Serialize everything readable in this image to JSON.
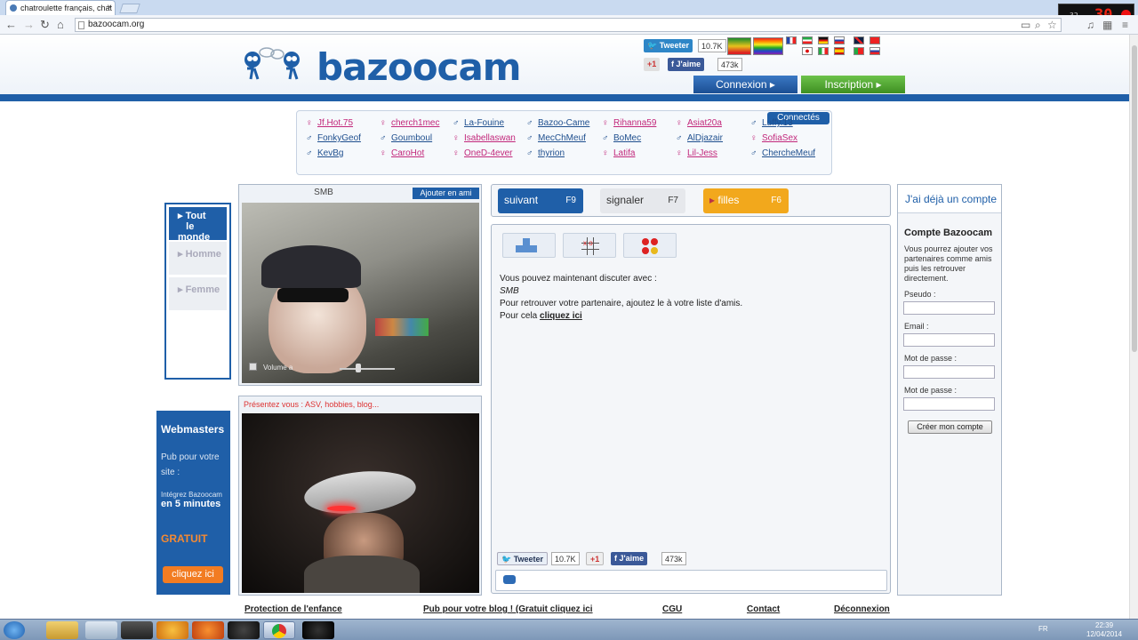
{
  "browser": {
    "tab_title": "chatroulette français, chat",
    "tab_close": "×",
    "url": "bazoocam.org",
    "rec_small": "32",
    "rec_big": "30"
  },
  "header": {
    "logo": "bazoocam",
    "tweet_label": "Tweeter",
    "tweet_count": "10.7K",
    "gplus_label": "+1",
    "fb_label": "J'aime",
    "fb_count": "473k",
    "connexion": "Connexion",
    "inscription": "Inscription"
  },
  "connected": {
    "title": "Connectés",
    "users": [
      {
        "name": "Jf.Hot.75",
        "g": "f"
      },
      {
        "name": "FonkyGeof",
        "g": "m"
      },
      {
        "name": "KevBg",
        "g": "m"
      },
      {
        "name": "cherch1mec",
        "g": "f"
      },
      {
        "name": "Goumboul",
        "g": "m"
      },
      {
        "name": "CaroHot",
        "g": "f"
      },
      {
        "name": "La-Fouine",
        "g": "m"
      },
      {
        "name": "Isabellaswan",
        "g": "f"
      },
      {
        "name": "OneD-4ever",
        "g": "f"
      },
      {
        "name": "Bazoo-Came",
        "g": "m"
      },
      {
        "name": "MecChMeuf",
        "g": "m"
      },
      {
        "name": "thyrion",
        "g": "m"
      },
      {
        "name": "Rihanna59",
        "g": "f"
      },
      {
        "name": "BoMec",
        "g": "m"
      },
      {
        "name": "Latifa",
        "g": "f"
      },
      {
        "name": "Asiat20a",
        "g": "f"
      },
      {
        "name": "AlDjazair",
        "g": "m"
      },
      {
        "name": "Lil-Jess",
        "g": "f"
      },
      {
        "name": "Luffy.13",
        "g": "m"
      },
      {
        "name": "SofiaSex",
        "g": "f"
      },
      {
        "name": "ChercheMeuf",
        "g": "m"
      }
    ]
  },
  "filter": {
    "all_1": "Tout",
    "all_2": "le monde",
    "men": "Homme",
    "women": "Femme"
  },
  "webmasters": {
    "title": "Webmasters",
    "pub": "Pub pour votre site :",
    "integrate": "Intégrez Bazoocam",
    "minutes": "en 5 minutes",
    "free": "GRATUIT",
    "cta": "cliquez ici"
  },
  "video": {
    "partner": "SMB",
    "add_friend": "Ajouter en ami",
    "volume": "Volume a",
    "self_hint": "Présentez vous : ASV, hobbies, blog..."
  },
  "actions": {
    "next": "suivant",
    "next_key": "F9",
    "report": "signaler",
    "report_key": "F7",
    "girls": "filles",
    "girls_key": "F6"
  },
  "chat": {
    "line1": "Vous pouvez maintenant discuter avec :",
    "partner": "SMB",
    "line3": "Pour retrouver votre partenaire, ajoutez le à votre liste d'amis.",
    "line4_pre": "Pour cela",
    "line4_link": "cliquez ici",
    "tweet": "Tweeter",
    "tweet_count": "10.7K",
    "gplus": "+1",
    "fb": "J'aime",
    "fb_count": "473k"
  },
  "account": {
    "have_account": "J'ai déjà un compte",
    "title": "Compte Bazoocam",
    "desc": "Vous pourrez ajouter vos partenaires comme amis puis les retrouver directement.",
    "pseudo": "Pseudo :",
    "email": "Email :",
    "password": "Mot de passe :",
    "password2": "Mot de passe :",
    "create": "Créer mon compte"
  },
  "footer": {
    "child": "Protection de l'enfance",
    "blog": "Pub pour votre blog ! (Gratuit cliquez ici",
    "cgu": "CGU",
    "contact": "Contact",
    "logout": "Déconnexion"
  },
  "taskbar": {
    "lang": "FR",
    "time": "22:39",
    "date": "12/04/2014"
  }
}
